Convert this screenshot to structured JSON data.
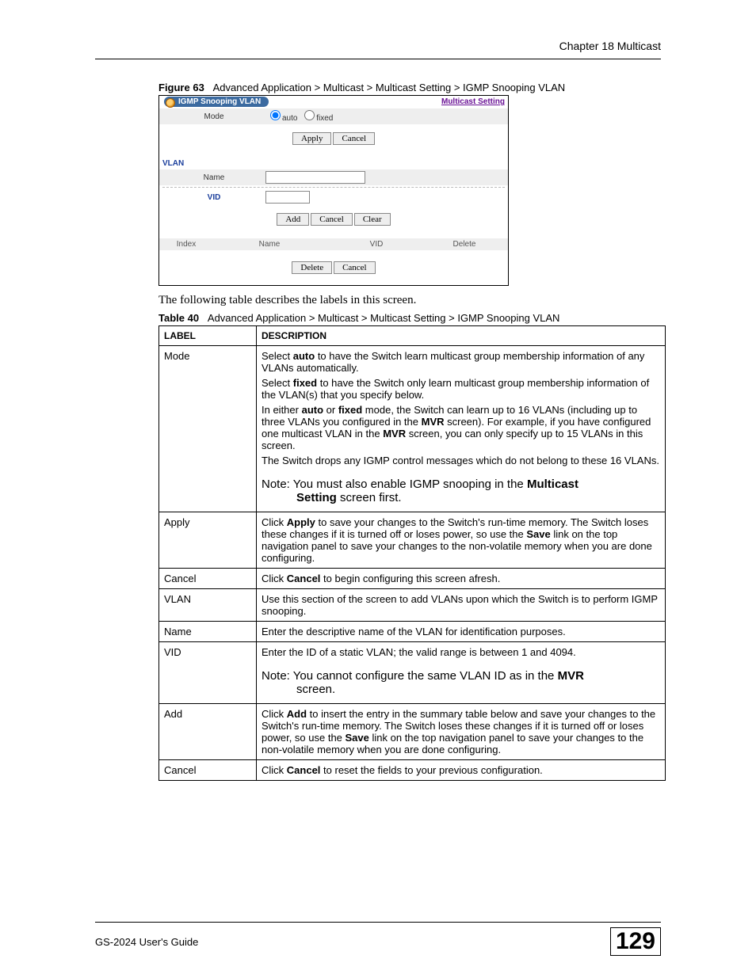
{
  "header": {
    "chapter": "Chapter 18 Multicast"
  },
  "figure": {
    "label": "Figure 63",
    "caption": "Advanced Application > Multicast > Multicast Setting > IGMP Snooping VLAN"
  },
  "screenshot": {
    "title": "IGMP Snooping VLAN",
    "link": "Multicast Setting",
    "mode_label": "Mode",
    "mode_auto": "auto",
    "mode_fixed": "fixed",
    "apply": "Apply",
    "cancel": "Cancel",
    "vlan_header": "VLAN",
    "name_label": "Name",
    "vid_label": "VID",
    "add": "Add",
    "clear": "Clear",
    "col_index": "Index",
    "col_name": "Name",
    "col_vid": "VID",
    "col_delete": "Delete",
    "delete": "Delete"
  },
  "intro": "The following table describes the labels in this screen.",
  "table_caption": {
    "label": "Table 40",
    "caption": "Advanced Application > Multicast > Multicast Setting > IGMP Snooping VLAN"
  },
  "th": {
    "label": "LABEL",
    "desc": "DESCRIPTION"
  },
  "rows": {
    "mode": {
      "label": "Mode",
      "p1a": "Select ",
      "p1b": "auto",
      "p1c": " to have the Switch learn multicast group membership information of any VLANs automatically.",
      "p2a": "Select ",
      "p2b": "fixed",
      "p2c": " to have the Switch only learn multicast group membership information of the VLAN(s) that you specify below.",
      "p3a": "In either ",
      "p3b": "auto",
      "p3c": " or ",
      "p3d": "fixed",
      "p3e": " mode, the Switch can learn up to 16 VLANs (including up to three VLANs you configured in the ",
      "p3f": "MVR",
      "p3g": " screen). For example, if you have configured one multicast VLAN in the ",
      "p3h": "MVR",
      "p3i": " screen, you can only specify up to 15 VLANs in this screen.",
      "p4": "The Switch drops any IGMP control messages which do not belong to these 16 VLANs.",
      "note_a": "Note: You must also enable IGMP snooping in the ",
      "note_b": "Multicast",
      "note_c": "Setting",
      "note_d": " screen first."
    },
    "apply": {
      "label": "Apply",
      "a": "Click ",
      "b": "Apply",
      "c": " to save your changes to the Switch's run-time memory. The Switch loses these changes if it is turned off or loses power, so use the ",
      "d": "Save",
      "e": " link on the top navigation panel to save your changes to the non-volatile memory when you are done configuring."
    },
    "cancel1": {
      "label": "Cancel",
      "a": "Click ",
      "b": "Cancel",
      "c": " to begin configuring this screen afresh."
    },
    "vlan": {
      "label": "VLAN",
      "a": "Use this section of the screen to add VLANs upon which the Switch is to perform IGMP snooping."
    },
    "name": {
      "label": "Name",
      "a": "Enter the descriptive name of the VLAN for identification purposes."
    },
    "vid": {
      "label": "VID",
      "a": "Enter the ID of a static VLAN; the valid range is between 1 and 4094.",
      "note_a": "Note: You cannot configure the same VLAN ID as in the ",
      "note_b": "MVR",
      "note_c": "screen."
    },
    "add": {
      "label": "Add",
      "a": "Click ",
      "b": "Add",
      "c": " to insert the entry in the summary table below and save your changes to the Switch's run-time memory. The Switch loses these changes if it is turned off or loses power, so use the ",
      "d": "Save",
      "e": " link on the top navigation panel to save your changes to the non-volatile memory when you are done configuring."
    },
    "cancel2": {
      "label": "Cancel",
      "a": "Click ",
      "b": "Cancel",
      "c": " to reset the fields to your previous configuration."
    }
  },
  "footer": {
    "left": "GS-2024 User's Guide",
    "page": "129"
  }
}
